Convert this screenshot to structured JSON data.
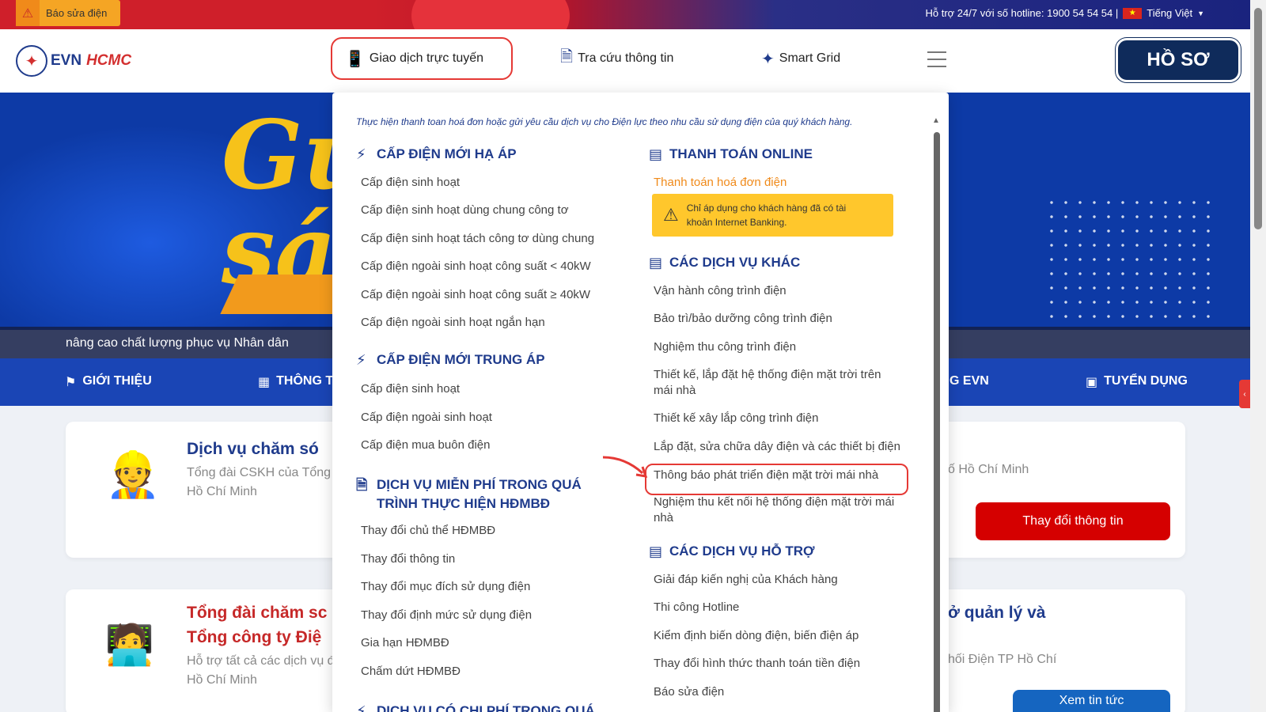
{
  "topbar": {
    "report_label": "Báo sửa điện",
    "hotline": "Hỗ trợ 24/7 với số hotline: 1900 54 54 54 |",
    "language": "Tiếng Việt"
  },
  "header": {
    "logo_evn": "EVN",
    "logo_hcmc": "HCMC",
    "nav": {
      "online": "Giao dịch trực tuyến",
      "lookup": "Tra cứu thông tin",
      "grid": "Smart Grid"
    },
    "profile": "HỒ SƠ"
  },
  "hero": {
    "caption": "nâng cao chất lượng phục vụ Nhân dân"
  },
  "mainnav": {
    "intro": "GIỚI THIỆU",
    "info": "THÔNG T",
    "evn": "G EVN",
    "jobs": "TUYỂN DỤNG"
  },
  "cards": {
    "c1_title": "Dịch vụ chăm só",
    "c1_text1": "Tổng đài CSKH của Tổng",
    "c1_text2": "Hồ Chí Minh",
    "c2_text": "ố Hồ Chí Minh",
    "c2_btn": "Thay đổi thông tin",
    "c3_title1": "Tổng đài chăm sc",
    "c3_title2": "Tổng công ty Điệ",
    "c3_text1": "Hỗ trợ tất cả các dịch vụ đ",
    "c3_text2": "Hồ Chí Minh",
    "c4_title": "ở quản lý và",
    "c4_text": "hối Điện TP Hồ Chí",
    "c4_btn": "Xem tin tức"
  },
  "dropdown": {
    "intro": "Thực hiện thanh toan hoá đơn hoặc gửi yêu cầu dịch vụ cho Điện lực theo nhu cầu sử dụng điện của quý khách hàng.",
    "left": {
      "h1": "CẤP ĐIỆN MỚI HẠ ÁP",
      "h1_items": [
        "Cấp điện sinh hoạt",
        "Cấp điện sinh hoạt dùng chung công tơ",
        "Cấp điện sinh hoạt tách công tơ dùng chung",
        "Cấp điện ngoài sinh hoạt công suất < 40kW",
        "Cấp điện ngoài sinh hoạt công suất ≥ 40kW",
        "Cấp điện ngoài sinh hoạt ngắn hạn"
      ],
      "h2": "CẤP ĐIỆN MỚI TRUNG ÁP",
      "h2_items": [
        "Cấp điện sinh hoạt",
        "Cấp điện ngoài sinh hoạt",
        "Cấp điện mua buôn điện"
      ],
      "h3_line1": "DỊCH VỤ MIỄN PHÍ TRONG QUÁ",
      "h3_line2": "TRÌNH THỰC HIỆN HĐMBĐ",
      "h3_items": [
        "Thay đổi chủ thể HĐMBĐ",
        "Thay đổi thông tin",
        "Thay đổi mục đích sử dụng điện",
        "Thay đổi định mức sử dụng điện",
        "Gia hạn HĐMBĐ",
        "Chấm dứt HĐMBĐ"
      ],
      "h4": "DỊCH VỤ CÓ CHI PHÍ TRONG QUÁ"
    },
    "right": {
      "h1": "THANH TOÁN ONLINE",
      "pay_link": "Thanh toán hoá đơn điện",
      "note_line1": "Chỉ áp dụng cho khách hàng đã có tài",
      "note_line2": "khoản Internet Banking.",
      "h2": "CÁC DỊCH VỤ KHÁC",
      "h2_items": [
        "Vận hành công trình điện",
        "Bảo trì/bảo dưỡng công trình điện",
        "Nghiệm thu công trình điện",
        "Thiết kế, lắp đặt hệ thống điện mặt trời trên",
        "mái nhà",
        "Thiết kế xây lắp công trình điện",
        "Lắp đặt, sửa chữa dây điện và các thiết bị điện",
        "Thông báo phát triển điện mặt trời mái nhà",
        "Nghiệm thu kết nối hệ thống điện mặt trời mái",
        "nhà"
      ],
      "h3": "CÁC DỊCH VỤ HỖ TRỢ",
      "h3_items": [
        "Giải đáp kiến nghị của Khách hàng",
        "Thi công Hotline",
        "Kiểm định biến dòng điện, biến điện áp",
        "Thay đổi hình thức thanh toán tiền điện",
        "Báo sửa điện"
      ]
    }
  },
  "colors": {
    "brand_blue": "#1f3b8c",
    "brand_red": "#d32f2f",
    "warning_yellow": "#ffc72c",
    "highlight_red": "#e53935"
  }
}
